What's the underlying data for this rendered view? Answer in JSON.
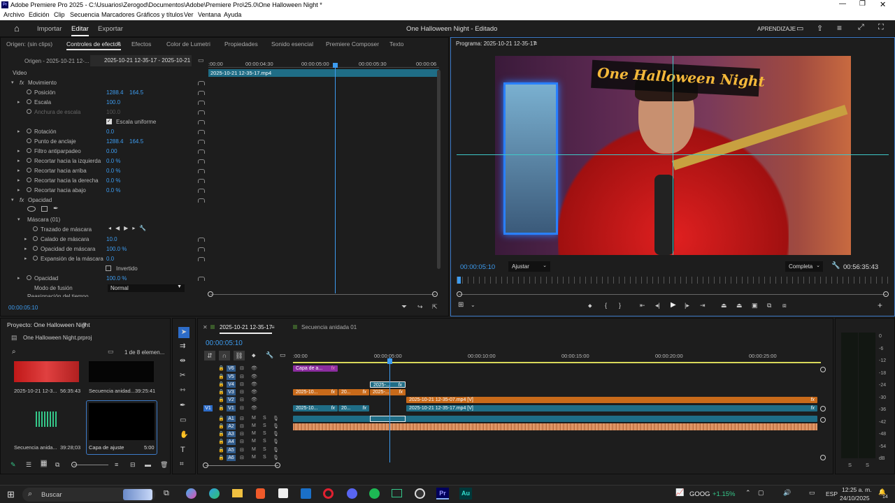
{
  "window": {
    "title": "Adobe Premiere Pro 2025 - C:\\Usuarios\\Zerogod\\Documentos\\Adobe\\Premiere Pro\\25.0\\One Halloween Night *"
  },
  "menu": [
    "Archivo",
    "Edición",
    "Clip",
    "Secuencia",
    "Marcadores",
    "Gráficos y títulos",
    "Ver",
    "Ventana",
    "Ayuda"
  ],
  "workspace": {
    "tabs": [
      "Importar",
      "Editar",
      "Exportar"
    ],
    "active": "Editar",
    "project_title": "One Halloween Night - Editado",
    "learning": "APRENDIZAJE"
  },
  "source_panel": {
    "origin": "Origen: (sin clips)",
    "tabs": [
      "Controles de efectos",
      "Efectos",
      "Color de Lumetri",
      "Propiedades",
      "Sonido esencial",
      "Premiere Composer",
      "Texto"
    ],
    "subtabs": [
      "Origen - 2025-10-21 12-...",
      "2025-10-21 12-35-17 - 2025-10-21 ..."
    ],
    "ruler": [
      ":00:00",
      "00:00:04:30",
      "00:00:05:00",
      "00:00:05:30",
      "00:00:06"
    ],
    "clip_name": "2025-10-21 12-35-17.mp4",
    "section_video": "Video",
    "section_motion": "Movimiento",
    "properties": [
      {
        "label": "Posición",
        "v1": "1288.4",
        "v2": "164.5"
      },
      {
        "label": "Escala",
        "v1": "100.0",
        "v2": ""
      },
      {
        "label": "Anchura de escala",
        "v1": "100.0",
        "v2": ""
      },
      {
        "label": "Escala uniforme",
        "v1": "",
        "v2": ""
      },
      {
        "label": "Rotación",
        "v1": "0.0",
        "v2": ""
      },
      {
        "label": "Punto de anclaje",
        "v1": "1288.4",
        "v2": "164.5"
      },
      {
        "label": "Filtro antiparpadeo",
        "v1": "0.00",
        "v2": ""
      },
      {
        "label": "Recortar hacia la izquierda",
        "v1": "0.0 %",
        "v2": ""
      },
      {
        "label": "Recortar hacia arriba",
        "v1": "0.0 %",
        "v2": ""
      },
      {
        "label": "Recortar hacia la derecha",
        "v1": "0.0 %",
        "v2": ""
      },
      {
        "label": "Recortar hacia abajo",
        "v1": "0.0 %",
        "v2": ""
      }
    ],
    "opacity_section": "Opacidad",
    "mask": "Máscara (01)",
    "mask_props": [
      {
        "label": "Trazado de máscara",
        "v1": ""
      },
      {
        "label": "Calado de máscara",
        "v1": "10.0"
      },
      {
        "label": "Opacidad de máscara",
        "v1": "100.0 %"
      },
      {
        "label": "Expansión de la máscara",
        "v1": "0.0"
      },
      {
        "label": "Invertido",
        "v1": ""
      },
      {
        "label": "Opacidad",
        "v1": "100.0 %"
      },
      {
        "label": "Modo de fusión",
        "v1": "Normal"
      }
    ],
    "cut_label": "Reasignación del tiempo",
    "timecode": "00:00:05:10"
  },
  "program": {
    "title": "Programa: 2025-10-21 12-35-17",
    "overlay_text": "One Halloween Night",
    "timecode": "00:00:05:10",
    "fit": "Ajustar",
    "quality": "Completa",
    "duration": "00:56:35:43"
  },
  "project": {
    "title": "Proyecto: One Halloween Night",
    "file": "One Halloween Night.prproj",
    "count": "1 de 8 elemen...",
    "items": [
      {
        "name": "2025-10-21 12-3...",
        "duration": "56:35:43"
      },
      {
        "name": "Secuencia anidad...",
        "duration": "39:25:41"
      },
      {
        "name": "Secuencia anida...",
        "duration": "39:28;03"
      },
      {
        "name": "Capa de ajuste",
        "duration": "5:00"
      }
    ]
  },
  "timeline": {
    "tabs": [
      "2025-10-21 12-35-17",
      "Secuencia anidada 01"
    ],
    "timecode": "00:00:05:10",
    "ruler": [
      ":00:00",
      "00:00:05:00",
      "00:00:10:00",
      "00:00:15:00",
      "00:00:20:00",
      "00:00:25:00"
    ],
    "video_tracks": [
      "V6",
      "V5",
      "V4",
      "V3",
      "V2",
      "V1"
    ],
    "audio_tracks": [
      "A1",
      "A2",
      "A3",
      "A4",
      "A5",
      "A6"
    ],
    "source_patch": "V1",
    "clips": {
      "capa": "Capa de a...",
      "v4": "2025-...",
      "v3a": "2025-10...",
      "v3b": "20...",
      "v3c": "2025-...",
      "v2": "2025-10-21 12-35-07.mp4 [V]",
      "v1a": "2025-10...",
      "v1b": "20...",
      "v1c": "2025-10-21 12-35-17.mp4 [V]"
    }
  },
  "meter": {
    "scale": [
      "0",
      "-6",
      "-12",
      "-18",
      "-24",
      "-30",
      "-36",
      "-42",
      "-48",
      "-54",
      "dB"
    ],
    "solo": [
      "S",
      "S"
    ]
  },
  "taskbar": {
    "search": "Buscar",
    "stock": "GOOG",
    "stock_change": "+1.15%",
    "lang": "ESP",
    "time": "12:25 a. m.",
    "date": "24/10/2025",
    "notif": "14"
  },
  "colors": {
    "accent": "#3d9cf0",
    "clip_blue": "#1f6d86",
    "clip_orange": "#c86a1a",
    "clip_purple": "#8c2da0",
    "audio": "#d98a5a",
    "playhead": "#3d9cf0"
  }
}
